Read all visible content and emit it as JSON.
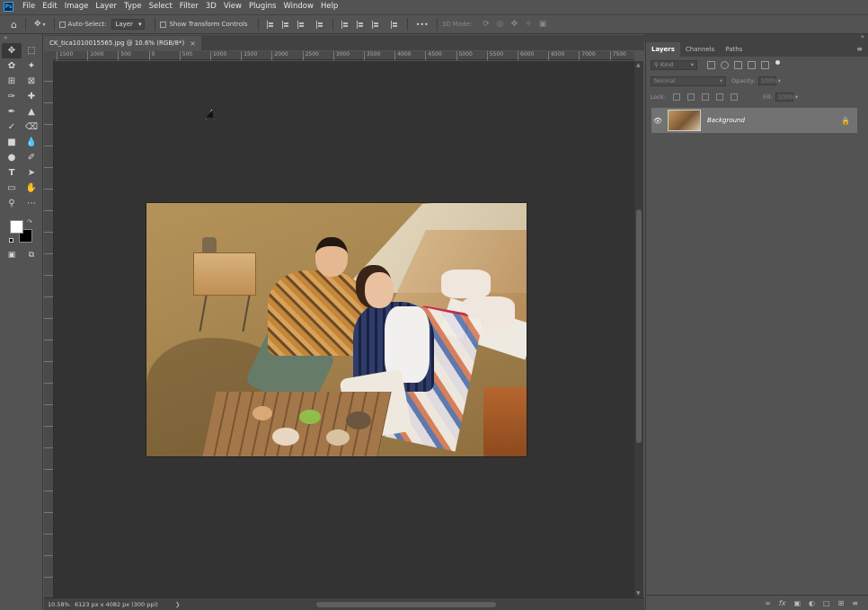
{
  "app": {
    "logo": "Ps"
  },
  "menu": [
    "File",
    "Edit",
    "Image",
    "Layer",
    "Type",
    "Select",
    "Filter",
    "3D",
    "View",
    "Plugins",
    "Window",
    "Help"
  ],
  "options": {
    "auto_select_label": "Auto-Select:",
    "auto_select_target": "Layer",
    "show_transform_label": "Show Transform Controls",
    "mode_3d_label": "3D Mode:",
    "more_label": "•••"
  },
  "document": {
    "tab_title": "CK_tica1010015565.jpg @ 10.6% (RGB/8*)",
    "close_glyph": "×"
  },
  "ruler": {
    "ticks": [
      "1500",
      "1000",
      "500",
      "0",
      "500",
      "1000",
      "1500",
      "2000",
      "2500",
      "3000",
      "3500",
      "4000",
      "4500",
      "5000",
      "5500",
      "6000",
      "6500",
      "7000",
      "7500"
    ]
  },
  "status": {
    "zoom": "10.58%",
    "doc_info": "6123 px x 4082 px (300 ppi)",
    "arrow": "❯"
  },
  "layers_panel": {
    "tabs": [
      "Layers",
      "Channels",
      "Paths"
    ],
    "active_tab": "Layers",
    "menu_glyph": "≡",
    "filter_placeholder": "Kind",
    "blend_mode": "Normal",
    "opacity_label": "Opacity:",
    "opacity_value": "100%",
    "lock_label": "Lock:",
    "fill_label": "Fill:",
    "fill_value": "100%",
    "layer_name": "Background",
    "bottom_icons": [
      "∞",
      "fx",
      "▣",
      "◐",
      "□",
      "⊞",
      "≡"
    ]
  }
}
